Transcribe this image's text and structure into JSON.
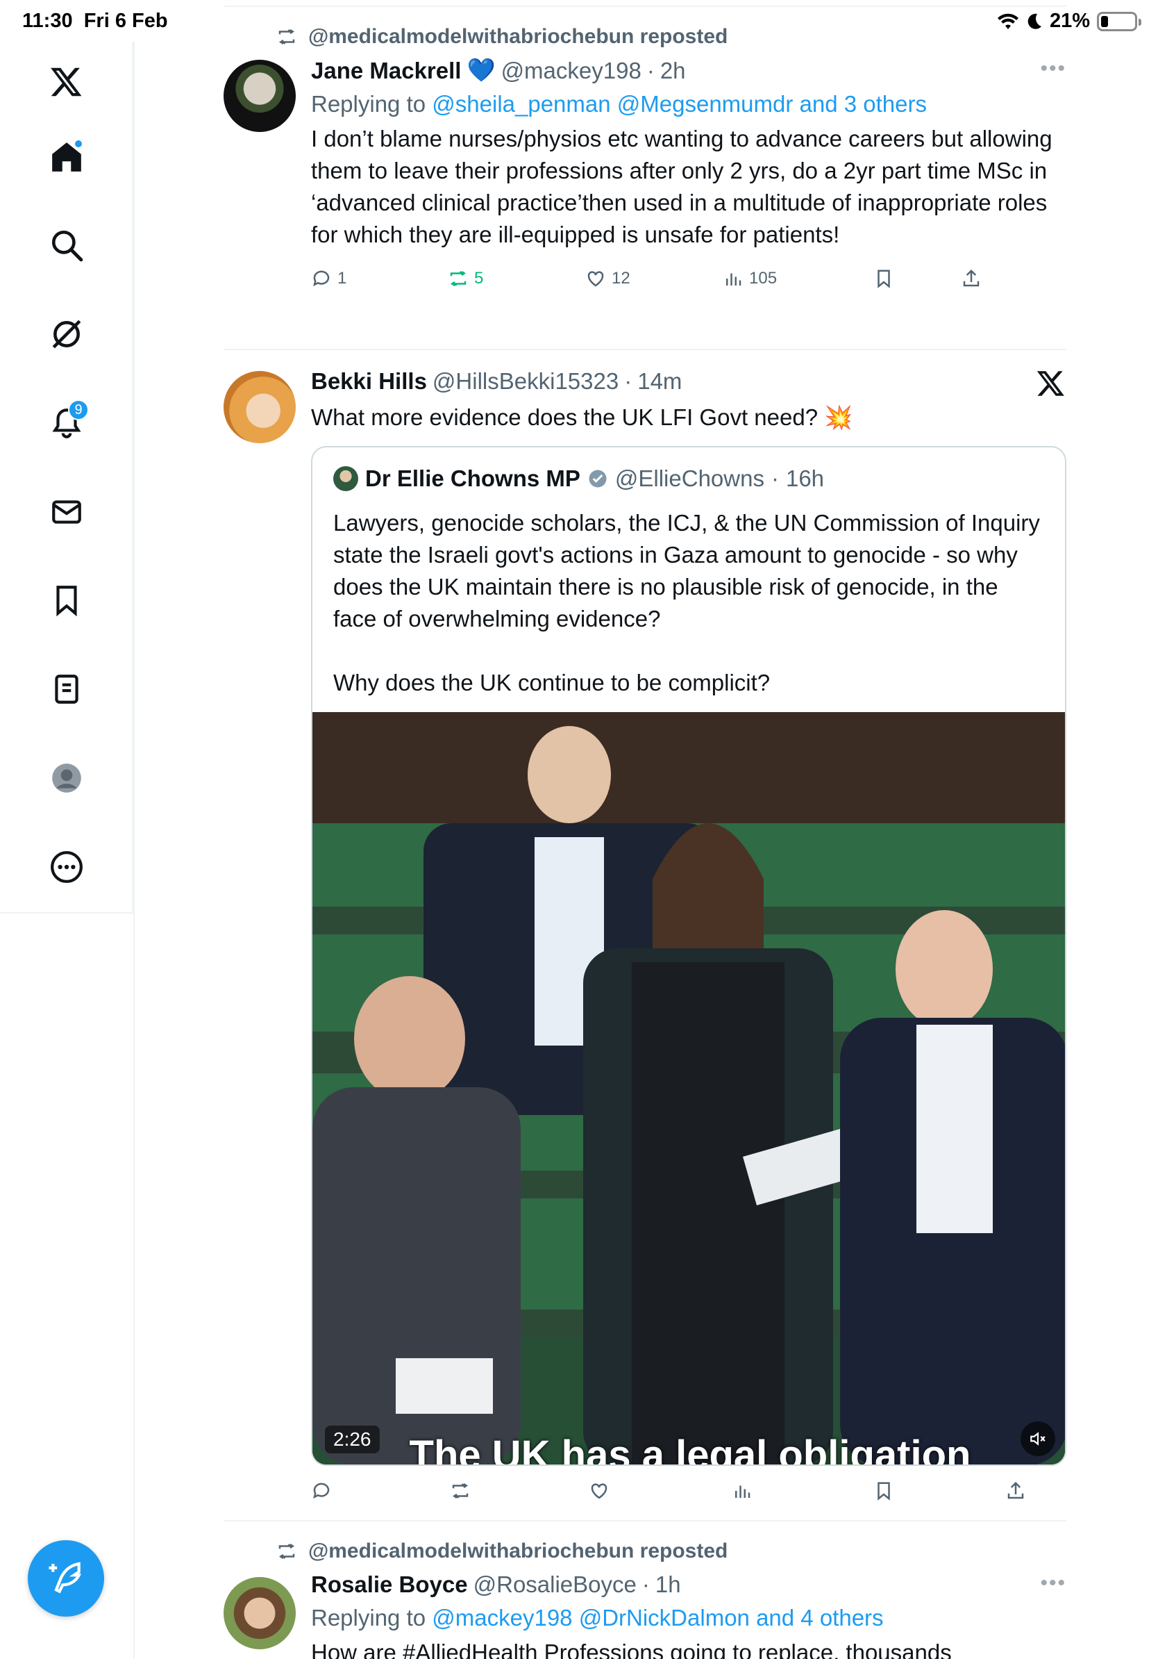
{
  "status_bar": {
    "time": "11:30",
    "date": "Fri 6 Feb",
    "battery": "21%",
    "battery_level": 0.21
  },
  "sidebar": {
    "items": [
      {
        "icon": "x-logo-icon"
      },
      {
        "icon": "home-icon",
        "has_dot": true
      },
      {
        "icon": "search-icon"
      },
      {
        "icon": "grok-icon"
      },
      {
        "icon": "notifications-icon",
        "badge": "9"
      },
      {
        "icon": "messages-icon"
      },
      {
        "icon": "bookmarks-icon"
      },
      {
        "icon": "lists-icon"
      },
      {
        "icon": "profile-icon"
      },
      {
        "icon": "more-icon"
      }
    ],
    "compose_icon": "compose-icon"
  },
  "tweets": [
    {
      "repost_label": "@medicalmodelwithabriochebun reposted",
      "name": "Jane Mackrell",
      "emoji": "💙",
      "handle": "@mackey198",
      "sep": "·",
      "time": "2h",
      "reply_prefix": "Replying to",
      "reply_to": "@sheila_penman @Megsenmumdr and 3 others",
      "text": "I don’t blame nurses/physios etc wanting to advance careers but allowing them to leave their professions after only 2 yrs, do a 2yr part time MSc in ‘advanced clinical practice’then used in a multitude of inappropriate roles for which they are ill-equipped is unsafe for patients!",
      "replies": "1",
      "reposts": "5",
      "likes": "12",
      "views": "105",
      "more": "•••"
    },
    {
      "name": "Bekki Hills",
      "handle": "@HillsBekki15323",
      "sep": "·",
      "time": "14m",
      "text": "What more evidence does the UK LFI Govt need? 💥",
      "quote": {
        "name": "Dr Ellie Chowns MP",
        "handle": "@EllieChowns",
        "sep": "·",
        "time": "16h",
        "text": "Lawyers, genocide scholars, the ICJ, & the UN Commission of Inquiry state the Israeli govt's actions in Gaza amount to genocide - so why does the UK maintain there is no plausible risk of genocide, in the face of overwhelming evidence?\n\nWhy does the UK continue to be complicit?",
        "video_duration": "2:26",
        "video_caption": "The UK has a legal obligation"
      }
    },
    {
      "repost_label": "@medicalmodelwithabriochebun reposted",
      "name": "Rosalie Boyce",
      "handle": "@RosalieBoyce",
      "sep": "·",
      "time": "1h",
      "reply_prefix": "Replying to",
      "reply_to": "@mackey198 @DrNickDalmon and 4 others",
      "text": "How are #AlliedHealth Professions going to replace, thousands",
      "more": "•••"
    }
  ],
  "colors": {
    "accent": "#1d9bf0",
    "repost_green": "#00ba7c",
    "muted": "#536471"
  }
}
